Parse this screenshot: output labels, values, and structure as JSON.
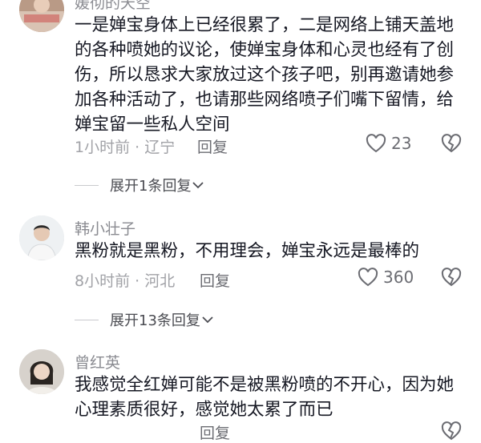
{
  "comments": [
    {
      "username": "媛彻的天空",
      "text": "一是婵宝身体上已经很累了，二是网络上铺天盖地的各种喷她的议论，使婵宝身体和心灵也经有了创伤，所以恳求大家放过这个孩子吧，别再邀请她参加各种活动了，也请那些网络喷子们嘴下留情，给婵宝留一些私人空间",
      "meta": "1小时前 · 辽宁",
      "reply_label": "回复",
      "likes": "23",
      "expand_label": "展开1条回复"
    },
    {
      "username": "韩小壮子",
      "text": "黑粉就是黑粉，不用理会，婵宝永远是最棒的",
      "meta": "8小时前 · 河北",
      "reply_label": "回复",
      "likes": "360",
      "expand_label": "展开13条回复"
    },
    {
      "username": "曾红英",
      "text": "我感觉全红婵可能不是被黑粉喷的不开心，因为她心理素质很好，感觉她太累了而已",
      "meta": "",
      "reply_label": "回复",
      "likes": ""
    }
  ],
  "icons": {
    "like": "heart-outline-icon",
    "dislike": "broken-heart-icon",
    "expand": "chevron-down-icon"
  },
  "colors": {
    "text": "#161823",
    "meta": "#a1a2a7",
    "username": "#8a8b91"
  }
}
